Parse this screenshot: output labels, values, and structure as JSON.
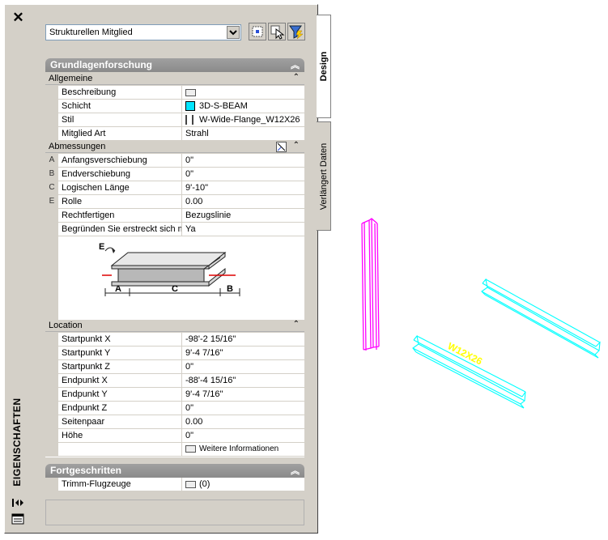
{
  "palette": {
    "title": "EIGENSCHAFTEN",
    "object_select": {
      "value": "Strukturellen Mitglied"
    },
    "tabs": [
      {
        "label": "Design"
      },
      {
        "label": "Verlängert Daten"
      }
    ]
  },
  "sections": {
    "basic": {
      "title": "Grundlagenforschung",
      "general": {
        "title": "Allgemeine",
        "rows": [
          {
            "name": "Beschreibung",
            "value": ""
          },
          {
            "name": "Schicht",
            "value": "3D-S-BEAM"
          },
          {
            "name": "Stil",
            "value": "W-Wide-Flange_W12X26"
          },
          {
            "name": "Mitglied Art",
            "value": "Strahl"
          }
        ]
      },
      "dimensions": {
        "title": "Abmessungen",
        "rows": [
          {
            "key": "A",
            "name": "Anfangsverschiebung",
            "value": "0\""
          },
          {
            "key": "B",
            "name": "Endverschiebung",
            "value": "0\""
          },
          {
            "key": "C",
            "name": "Logischen Länge",
            "value": "9'-10\""
          },
          {
            "key": "E",
            "name": "Rolle",
            "value": "0.00"
          },
          {
            "key": "",
            "name": "Rechtfertigen",
            "value": "Bezugslinie"
          },
          {
            "key": "",
            "name": "Begründen Sie erstreckt sich mit",
            "value": "Ya"
          }
        ],
        "diagram_labels": {
          "e": "E",
          "a": "A",
          "b": "B",
          "c": "C"
        }
      },
      "location": {
        "title": "Location",
        "rows": [
          {
            "name": "Startpunkt X",
            "value": "-98'-2 15/16\""
          },
          {
            "name": "Startpunkt Y",
            "value": "9'-4 7/16\""
          },
          {
            "name": "Startpunkt Z",
            "value": "0\""
          },
          {
            "name": "Endpunkt X",
            "value": "-88'-4 15/16\""
          },
          {
            "name": "Endpunkt Y",
            "value": "9'-4 7/16\""
          },
          {
            "name": "Endpunkt Z",
            "value": "0\""
          },
          {
            "name": "Seitenpaar",
            "value": "0.00"
          },
          {
            "name": "Höhe",
            "value": "0\""
          }
        ],
        "more_info": "Weitere Informationen"
      }
    },
    "advanced": {
      "title": "Fortgeschritten",
      "rows": [
        {
          "name": "Trimm-Flugzeuge",
          "value": "(0)"
        }
      ]
    }
  },
  "drawing": {
    "beam_label": "W12X26",
    "colors": {
      "magenta": "#ff00ff",
      "cyan": "#00ffff",
      "yellow": "#ffff00"
    }
  }
}
